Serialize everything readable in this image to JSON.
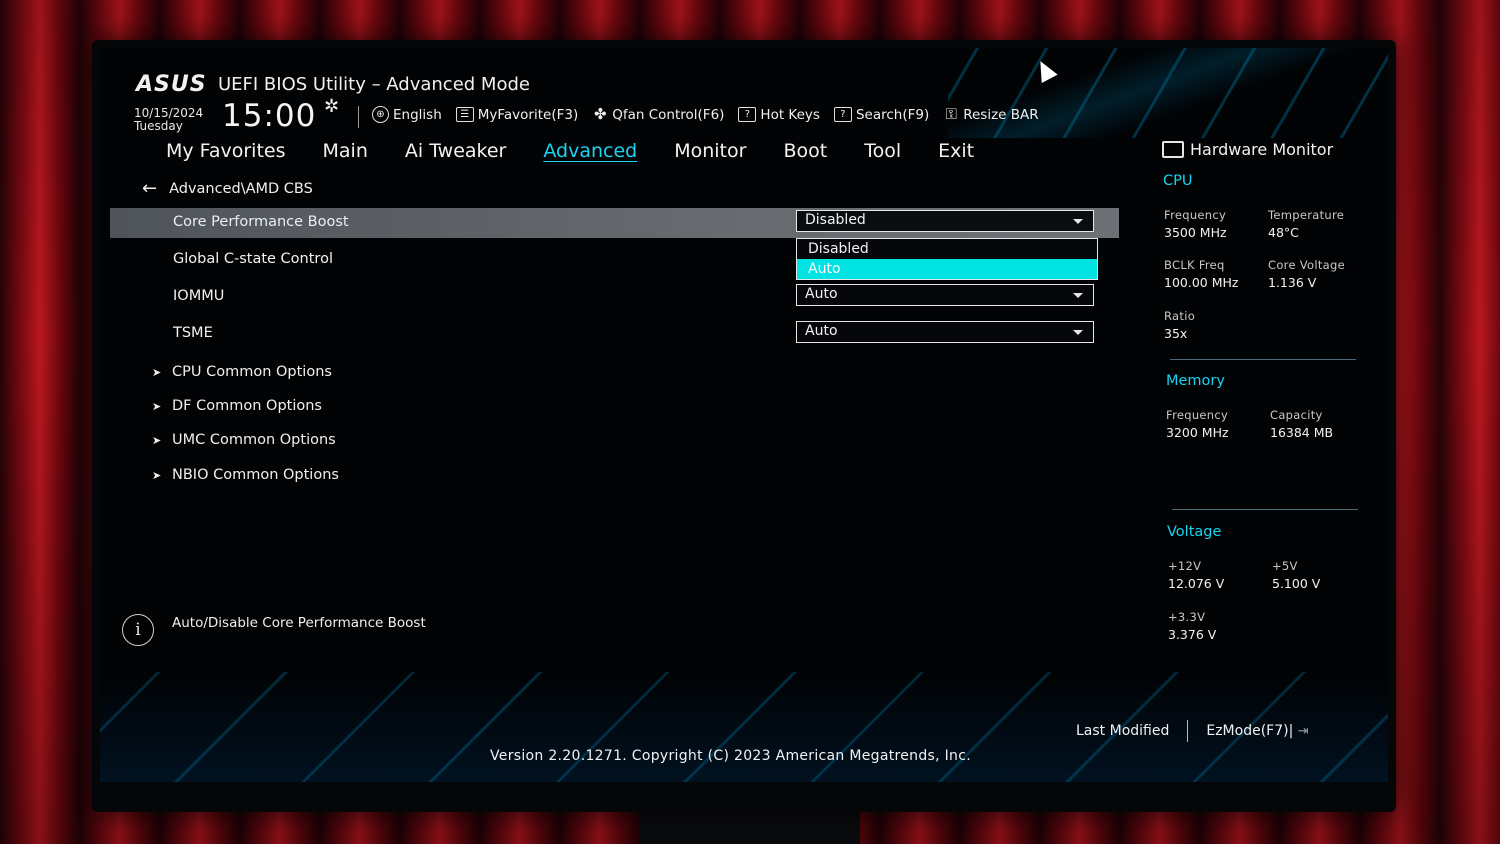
{
  "header": {
    "logo": "ASUS",
    "title": "UEFI BIOS Utility – Advanced Mode",
    "date": "10/15/2024",
    "day": "Tuesday",
    "time": "15:00",
    "toolbar": [
      {
        "label": "English",
        "icon": "globe-icon"
      },
      {
        "label": "MyFavorite(F3)",
        "icon": "favorite-icon"
      },
      {
        "label": "Qfan Control(F6)",
        "icon": "fan-icon"
      },
      {
        "label": "Hot Keys",
        "icon": "help-icon"
      },
      {
        "label": "Search(F9)",
        "icon": "help-icon"
      },
      {
        "label": "Resize BAR",
        "icon": "resize-bar-icon"
      }
    ]
  },
  "tabs": [
    "My Favorites",
    "Main",
    "Ai Tweaker",
    "Advanced",
    "Monitor",
    "Boot",
    "Tool",
    "Exit"
  ],
  "active_tab": "Advanced",
  "breadcrumb": "Advanced\\AMD CBS",
  "settings": [
    {
      "label": "Core Performance Boost",
      "value": "Disabled",
      "selected": true
    },
    {
      "label": "Global C-state Control",
      "value": ""
    },
    {
      "label": "IOMMU",
      "value": "Auto"
    },
    {
      "label": "TSME",
      "value": "Auto"
    }
  ],
  "dropdown_options": [
    "Disabled",
    "Auto"
  ],
  "dropdown_highlighted": "Auto",
  "submenus": [
    "CPU Common Options",
    "DF Common Options",
    "UMC Common Options",
    "NBIO Common Options"
  ],
  "help_text": "Auto/Disable Core Performance Boost",
  "hardware_monitor": {
    "title": "Hardware Monitor",
    "cpu": {
      "section": "CPU",
      "frequency_label": "Frequency",
      "frequency": "3500 MHz",
      "temperature_label": "Temperature",
      "temperature": "48°C",
      "bclk_label": "BCLK Freq",
      "bclk": "100.00 MHz",
      "core_voltage_label": "Core Voltage",
      "core_voltage": "1.136 V",
      "ratio_label": "Ratio",
      "ratio": "35x"
    },
    "memory": {
      "section": "Memory",
      "frequency_label": "Frequency",
      "frequency": "3200 MHz",
      "capacity_label": "Capacity",
      "capacity": "16384 MB"
    },
    "voltage": {
      "section": "Voltage",
      "v12_label": "+12V",
      "v12": "12.076 V",
      "v5_label": "+5V",
      "v5": "5.100 V",
      "v33_label": "+3.3V",
      "v33": "3.376 V"
    }
  },
  "footer": {
    "last_modified": "Last Modified",
    "ezmode": "EzMode(F7)|",
    "version": "Version 2.20.1271. Copyright (C) 2023 American Megatrends, Inc."
  },
  "colors": {
    "accent": "#19d3f0",
    "highlight": "#00e3e3",
    "selected_row": "#676b70"
  }
}
